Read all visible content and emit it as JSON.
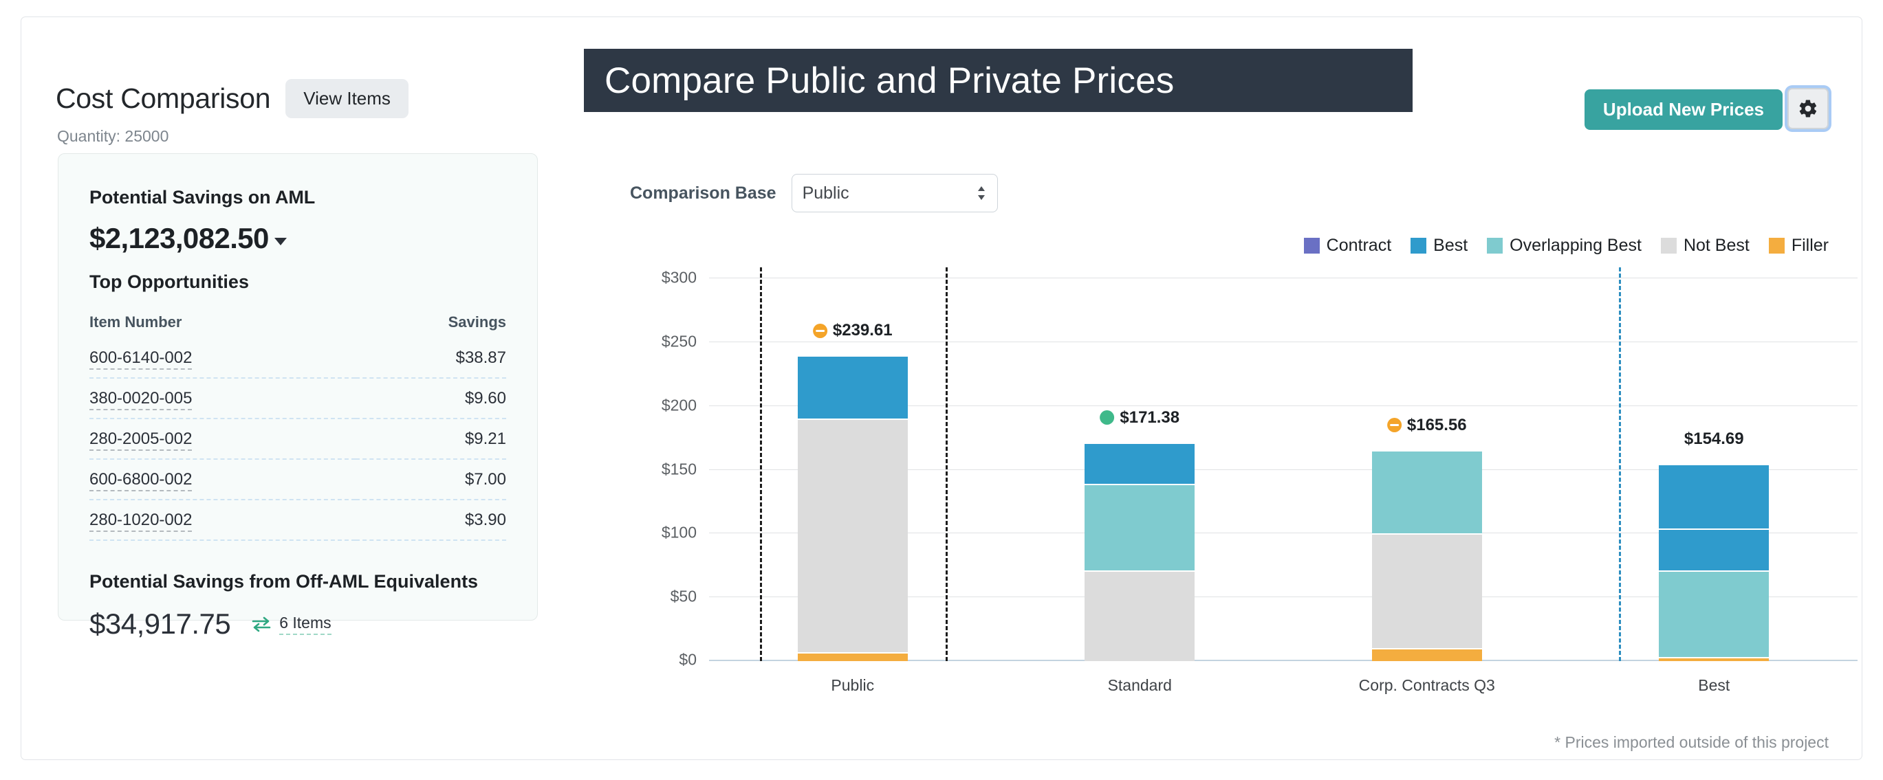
{
  "left_panel": {
    "title": "Cost Comparison",
    "view_items_label": "View Items",
    "quantity_line": "Quantity: 25000",
    "savings_card": {
      "aml_heading": "Potential Savings on AML",
      "aml_amount": "$2,123,082.50",
      "top_opportunities_heading": "Top Opportunities",
      "columns": [
        "Item Number",
        "Savings"
      ],
      "rows": [
        {
          "item_number": "600-6140-002",
          "savings": "$38.87"
        },
        {
          "item_number": "380-0020-005",
          "savings": "$9.60"
        },
        {
          "item_number": "280-2005-002",
          "savings": "$9.21"
        },
        {
          "item_number": "600-6800-002",
          "savings": "$7.00"
        },
        {
          "item_number": "280-1020-002",
          "savings": "$3.90"
        }
      ],
      "offaml_heading": "Potential Savings from Off-AML Equivalents",
      "offaml_amount": "$34,917.75",
      "offaml_items_label": "6 Items",
      "swap_icon": "exchange-arrows-icon",
      "caret_icon": "chevron-down-icon"
    }
  },
  "right_panel": {
    "banner_title": "Compare Public and Private Prices",
    "upload_button_label": "Upload New Prices",
    "gear_icon": "gear-icon",
    "comparison_base": {
      "label": "Comparison Base",
      "value": "Public",
      "options": [
        "Public",
        "Standard",
        "Corp. Contracts Q3",
        "Best"
      ]
    },
    "footnote": "* Prices imported outside of this project"
  },
  "colors": {
    "contract": "#6a70c4",
    "best": "#2f9bcc",
    "overlapping_best": "#7fcbcf",
    "not_best": "#dcdcdc",
    "filler": "#f4ad3f",
    "teal_button": "#38a3a0",
    "banner": "#2e3845",
    "badge_green": "#3fb98a",
    "badge_orange": "#f4a429",
    "marker_line_black": "#1d1d1d",
    "marker_line_blue": "#2d8ec0"
  },
  "chart_data": {
    "type": "bar",
    "stacked": true,
    "title": "Compare Public and Private Prices",
    "xlabel": "",
    "ylabel": "",
    "ylim": [
      0,
      300
    ],
    "yticks": [
      0,
      50,
      100,
      150,
      200,
      250,
      300
    ],
    "ytick_labels": [
      "$0",
      "$50",
      "$100",
      "$150",
      "$200",
      "$250",
      "$300"
    ],
    "grid": true,
    "legend_position": "top-right",
    "legend": [
      {
        "name": "Contract",
        "color": "#6a70c4"
      },
      {
        "name": "Best",
        "color": "#2f9bcc"
      },
      {
        "name": "Overlapping Best",
        "color": "#7fcbcf"
      },
      {
        "name": "Not Best",
        "color": "#dcdcdc"
      },
      {
        "name": "Filler",
        "color": "#f4ad3f"
      }
    ],
    "categories": [
      "Public",
      "Standard",
      "Corp. Contracts Q3",
      "Best"
    ],
    "totals": [
      239.61,
      171.38,
      165.56,
      154.69
    ],
    "total_labels": [
      "$239.61",
      "$171.38",
      "$165.56",
      "$154.69"
    ],
    "badges": [
      {
        "category": "Public",
        "type": "minus",
        "color": "#f4a429"
      },
      {
        "category": "Standard",
        "type": "dot",
        "color": "#3fb98a"
      },
      {
        "category": "Corp. Contracts Q3",
        "type": "minus",
        "color": "#f4a429"
      },
      {
        "category": "Best",
        "type": "none",
        "color": ""
      }
    ],
    "bars": [
      {
        "category": "Public",
        "total": 239.61,
        "segments": [
          {
            "series": "Filler",
            "value": 7.0,
            "color": "#f4ad3f"
          },
          {
            "series": "Not Best",
            "value": 183.0,
            "color": "#dcdcdc"
          },
          {
            "series": "Best",
            "value": 49.61,
            "color": "#2f9bcc"
          }
        ]
      },
      {
        "category": "Standard",
        "total": 171.38,
        "segments": [
          {
            "series": "Not Best",
            "value": 71.0,
            "color": "#dcdcdc"
          },
          {
            "series": "Overlapping Best",
            "value": 68.0,
            "color": "#7fcbcf"
          },
          {
            "series": "Best",
            "value": 32.38,
            "color": "#2f9bcc"
          }
        ]
      },
      {
        "category": "Corp. Contracts Q3",
        "total": 165.56,
        "segments": [
          {
            "series": "Filler",
            "value": 10.0,
            "color": "#f4ad3f"
          },
          {
            "series": "Not Best",
            "value": 90.0,
            "color": "#dcdcdc"
          },
          {
            "series": "Overlapping Best",
            "value": 65.56,
            "color": "#7fcbcf"
          }
        ]
      },
      {
        "category": "Best",
        "total": 154.69,
        "segments": [
          {
            "series": "Filler",
            "value": 3.5,
            "color": "#f4ad3f"
          },
          {
            "series": "Overlapping Best",
            "value": 67.5,
            "color": "#7fcbcf"
          },
          {
            "series": "Best",
            "value": 33.0,
            "color": "#2f9bcc"
          },
          {
            "series": "Best",
            "value": 50.69,
            "color": "#2f9bcc"
          }
        ]
      }
    ],
    "reference_lines": [
      {
        "style": "dashed",
        "color": "#1d1d1d",
        "near": "Public",
        "side": "left"
      },
      {
        "style": "dashed",
        "color": "#1d1d1d",
        "near": "Public",
        "side": "right"
      },
      {
        "style": "dashed",
        "color": "#2d8ec0",
        "near": "Best",
        "side": "left"
      }
    ],
    "annotation": "* Prices imported outside of this project"
  }
}
